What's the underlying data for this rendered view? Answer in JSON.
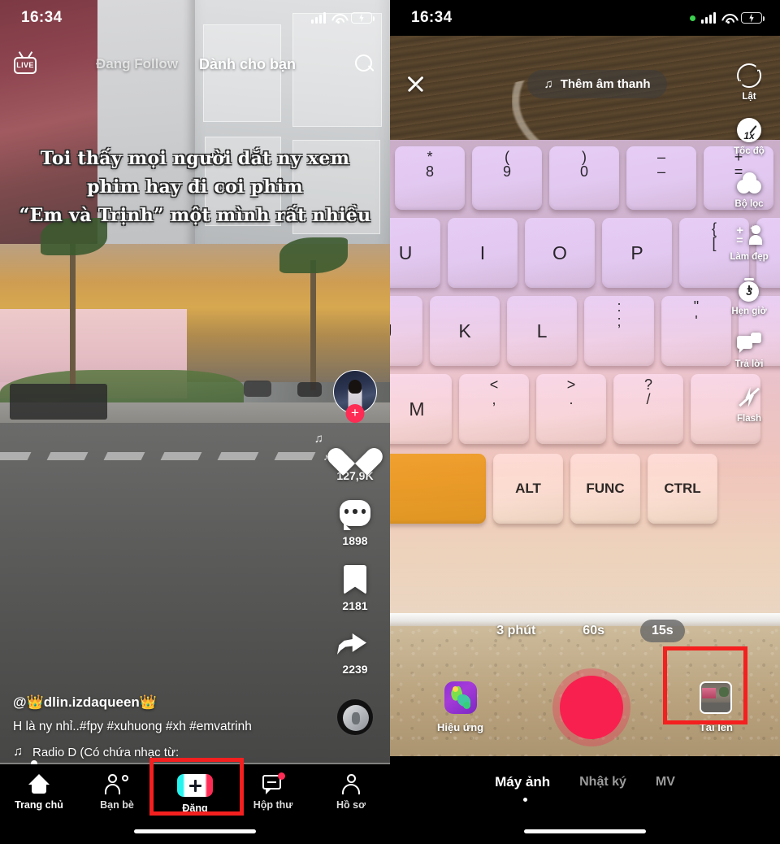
{
  "feed": {
    "status_bar": {
      "time": "16:34",
      "battery_state": "charging",
      "wifi": "wifi-icon",
      "signal": "signal-icon"
    },
    "top_nav": {
      "live_label": "LIVE",
      "tabs": [
        {
          "label": "Đang Follow",
          "active": false
        },
        {
          "label": "Dành cho bạn",
          "active": true
        }
      ],
      "search_icon": "search-icon"
    },
    "video_caption_lines": [
      "Toi thấy mọi người dắt ny xem",
      "phim hay đi coi phim",
      "“Em và Trịnh” một mình rất nhiều"
    ],
    "actions": {
      "avatar_follow_label": "+",
      "like_count": "127,9K",
      "comment_count": "1898",
      "bookmark_count": "2181",
      "share_count": "2239"
    },
    "meta": {
      "username": "@👑dlin.izdaqueen👑",
      "description": "H là ny nhỉ..#fpy #xuhuong #xh #emvatrinh",
      "music": "Radio D (Có chứa nhạc từ:"
    },
    "tabbar": [
      {
        "label": "Trang chủ",
        "icon": "home-icon",
        "active": true,
        "badge": false
      },
      {
        "label": "Bạn bè",
        "icon": "friends-icon",
        "active": false,
        "badge": false
      },
      {
        "label": "Đăng",
        "icon": "post-plus-icon",
        "active": false,
        "badge": false,
        "highlighted": true
      },
      {
        "label": "Hộp thư",
        "icon": "inbox-icon",
        "active": false,
        "badge": true
      },
      {
        "label": "Hồ sơ",
        "icon": "profile-icon",
        "active": false,
        "badge": false
      }
    ]
  },
  "camera": {
    "status_bar": {
      "time": "16:34",
      "battery_state": "charging",
      "recording_dot": true
    },
    "top": {
      "close_icon": "close-icon",
      "add_sound_label": "Thêm âm thanh",
      "add_sound_icon": "music-note-icon"
    },
    "tools": [
      {
        "label": "Lật",
        "icon": "flip-camera-icon"
      },
      {
        "label": "Tốc độ",
        "icon": "speed-icon",
        "value": "1x"
      },
      {
        "label": "Bộ lọc",
        "icon": "filter-icon"
      },
      {
        "label": "Làm đẹp",
        "icon": "beauty-icon"
      },
      {
        "label": "Hẹn giờ",
        "icon": "timer-icon",
        "value": "3"
      },
      {
        "label": "Trả lời",
        "icon": "reply-icon"
      },
      {
        "label": "Flash",
        "icon": "flash-off-icon"
      }
    ],
    "durations": [
      {
        "label": "3 phút",
        "selected": false
      },
      {
        "label": "60s",
        "selected": false
      },
      {
        "label": "15s",
        "selected": true
      }
    ],
    "controls": {
      "effects_label": "Hiệu ứng",
      "effects_icon": "effects-icon",
      "record_button": "record-button",
      "upload_label": "Tải lên",
      "upload_icon": "upload-thumbnail-icon",
      "upload_highlighted": true
    },
    "modes": [
      {
        "label": "Máy ảnh",
        "active": true
      },
      {
        "label": "Nhật ký",
        "active": false
      },
      {
        "label": "MV",
        "active": false
      }
    ]
  },
  "keyboard_keys": {
    "row_numbers": [
      "*\n8",
      "(\n9",
      ")\n0",
      "–\n–",
      "+\n="
    ],
    "row_letters": [
      "U",
      "I",
      "O",
      "P",
      "{\n["
    ],
    "row_home": [
      "J",
      "K",
      "L",
      ":\n;",
      "\"\n'"
    ],
    "row_bottom": [
      "M",
      "<\n,",
      ">\n.",
      "?\n/"
    ],
    "row_modifiers": [
      "ALT",
      "FUNC",
      "CTRL"
    ]
  },
  "annotations": {
    "highlight_color": "#f41f1f",
    "boxes": [
      "dang-tab",
      "tai-len-button"
    ]
  },
  "colors": {
    "tiktok_red": "#fe2c55",
    "tiktok_cyan": "#25f4ee",
    "record_red": "#f8204f",
    "battery_green": "#35d14f",
    "highlight_red": "#f41f1f"
  }
}
